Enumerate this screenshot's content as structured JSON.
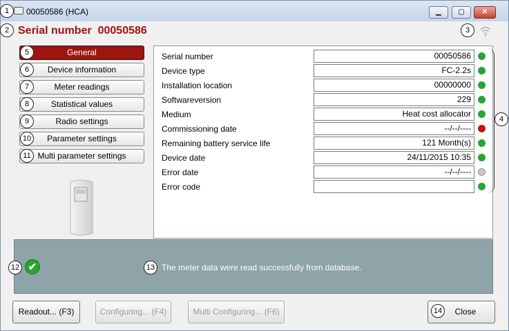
{
  "window": {
    "title": "00050586 (HCA)",
    "minimize_glyph": "▁",
    "maximize_glyph": "▢",
    "close_glyph": "✕"
  },
  "header": {
    "serial_label": "Serial number",
    "serial_value": "00050586",
    "signal_icon": "wifi-signal-icon"
  },
  "nav": {
    "items": [
      {
        "label": "General",
        "active": true
      },
      {
        "label": "Device information"
      },
      {
        "label": "Meter readings"
      },
      {
        "label": "Statistical values"
      },
      {
        "label": "Radio settings"
      },
      {
        "label": "Parameter settings"
      },
      {
        "label": "Multi parameter settings"
      }
    ]
  },
  "details": {
    "rows": [
      {
        "label": "Serial number",
        "value": "00050586",
        "status": "green"
      },
      {
        "label": "Device type",
        "value": "FC-2.2s",
        "status": "green"
      },
      {
        "label": "Installation location",
        "value": "00000000",
        "status": "green"
      },
      {
        "label": "Softwareversion",
        "value": "229",
        "status": "green"
      },
      {
        "label": "Medium",
        "value": "Heat cost allocator",
        "status": "green"
      },
      {
        "label": "Commissioning date",
        "value": "--/--/----",
        "status": "red"
      },
      {
        "label": "Remaining battery service life",
        "value": "121 Month(s)",
        "status": "green"
      },
      {
        "label": "Device date",
        "value": "24/11/2015 10:35",
        "status": "green"
      },
      {
        "label": "Error date",
        "value": "--/--/----",
        "status": "grey"
      },
      {
        "label": "Error code",
        "value": "",
        "status": "green"
      }
    ]
  },
  "status": {
    "message": "The meter data were read successfully from database.",
    "check_glyph": "✔"
  },
  "buttons": {
    "readout": "Readout... (F3)",
    "configuring": "Configuring... (F4)",
    "multi_configuring": "Multi Configuring... (F6)",
    "close": "Close"
  },
  "badges": {
    "b1": "1",
    "b2": "2",
    "b3": "3",
    "b4": "4",
    "b5": "5",
    "b6": "6",
    "b7": "7",
    "b8": "8",
    "b9": "9",
    "b10": "10",
    "b11": "11",
    "b12": "12",
    "b13": "13",
    "b14": "14"
  },
  "colors": {
    "accent": "#a0140f",
    "status_panel": "#8fa4a8",
    "green": "#2aa52f",
    "red": "#c0140f",
    "grey": "#c8c8c8"
  }
}
